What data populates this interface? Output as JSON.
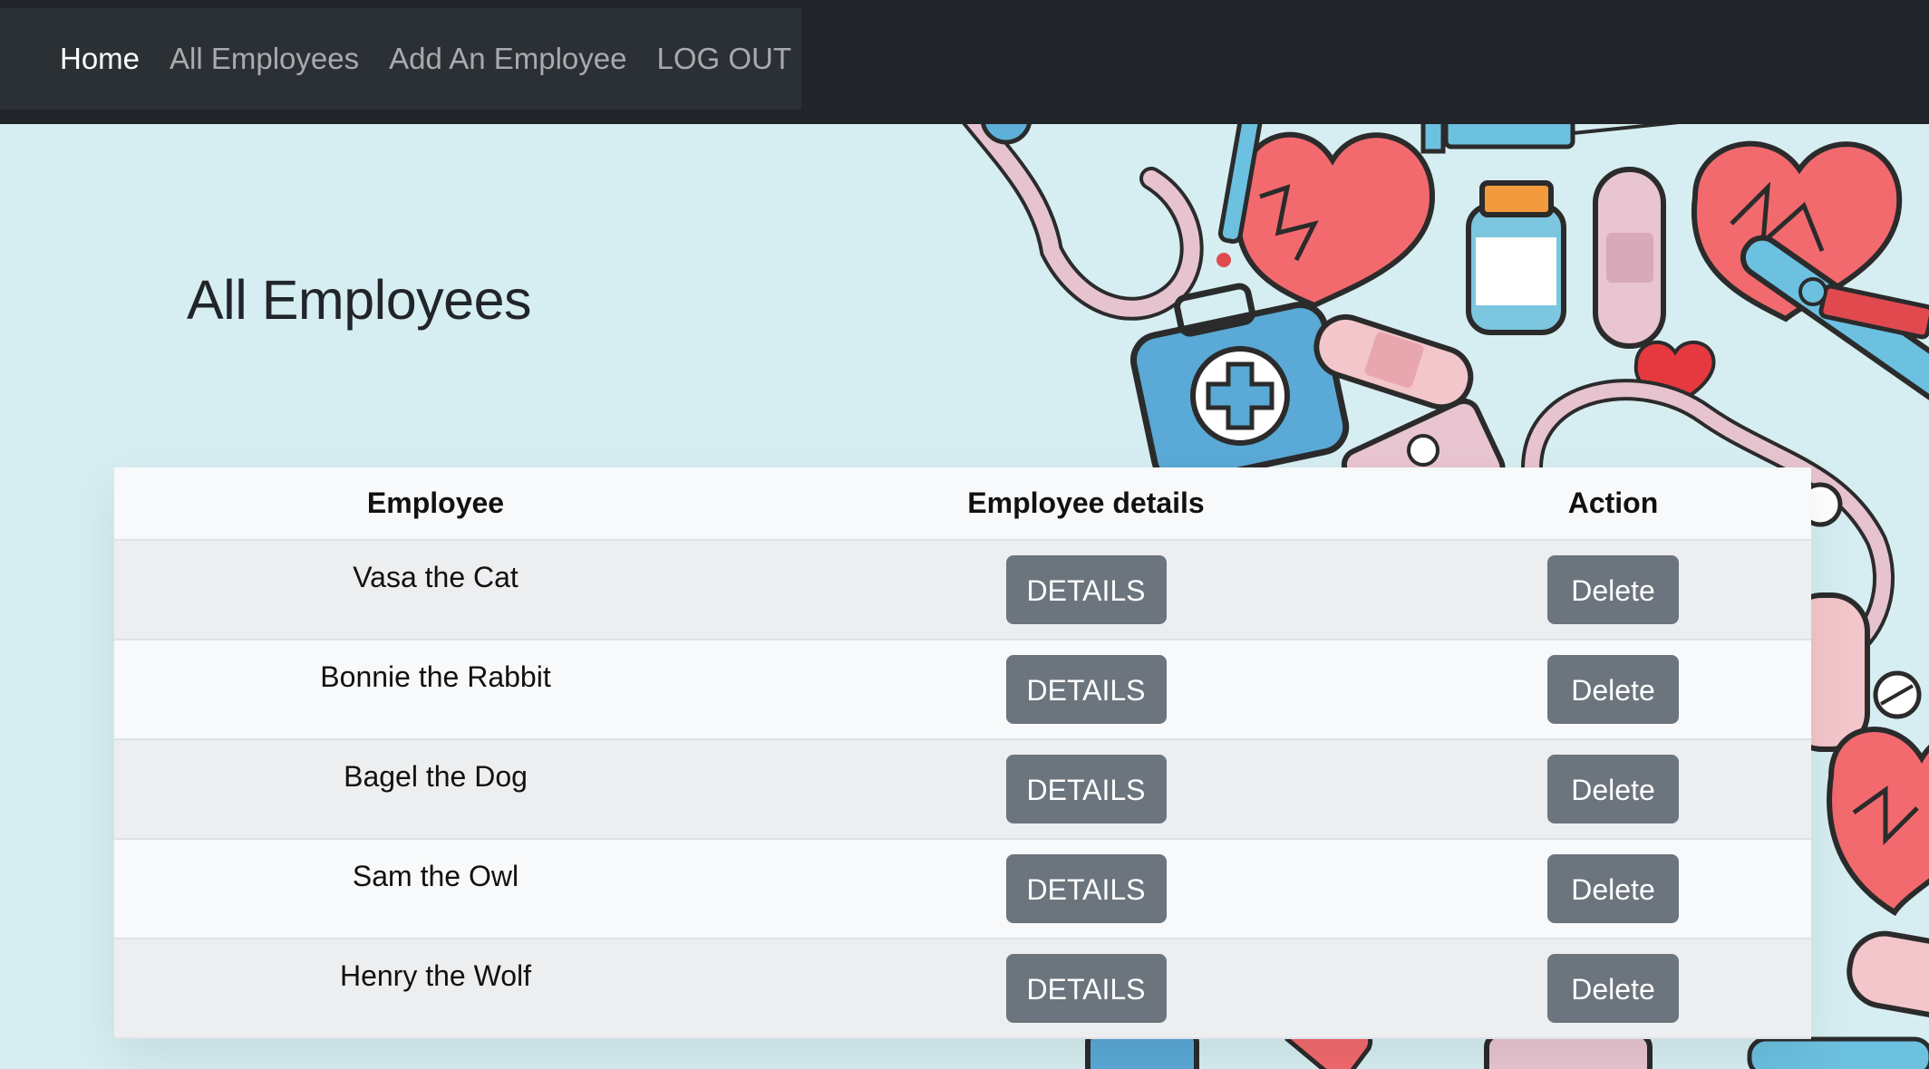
{
  "nav": {
    "items": [
      {
        "label": "Home",
        "active": true
      },
      {
        "label": "All Employees",
        "active": false
      },
      {
        "label": "Add An Employee",
        "active": false
      },
      {
        "label": "LOG OUT",
        "active": false
      }
    ]
  },
  "page": {
    "title": "All Employees"
  },
  "table": {
    "headers": [
      "Employee",
      "Employee details",
      "Action"
    ],
    "rows": [
      {
        "name": "Vasa the Cat",
        "details_label": "DETAILS",
        "action_label": "Delete"
      },
      {
        "name": "Bonnie the Rabbit",
        "details_label": "DETAILS",
        "action_label": "Delete"
      },
      {
        "name": "Bagel the Dog",
        "details_label": "DETAILS",
        "action_label": "Delete"
      },
      {
        "name": "Sam the Owl",
        "details_label": "DETAILS",
        "action_label": "Delete"
      },
      {
        "name": "Henry the Wolf",
        "details_label": "DETAILS",
        "action_label": "Delete"
      }
    ]
  },
  "colors": {
    "navbar": "#212529",
    "page_background": "#d6eef1",
    "button": "#6c757d"
  },
  "decor_icons": [
    "stethoscope-icon",
    "heart-icon",
    "pill-bottle-icon",
    "bandage-icon",
    "first-aid-kit-icon",
    "syringe-icon",
    "thermometer-icon"
  ]
}
